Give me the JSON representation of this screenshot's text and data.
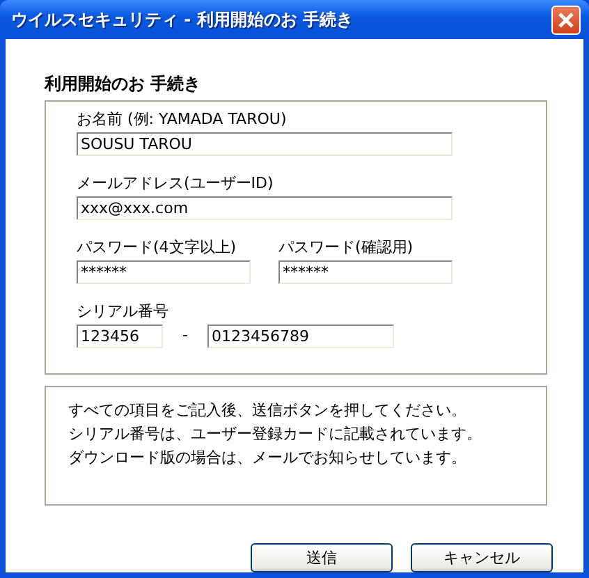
{
  "window": {
    "title": "ウイルスセキュリティ - 利用開始のお 手続き"
  },
  "heading": "利用開始のお 手続き",
  "fields": [
    {
      "label": "お名前 (例: YAMADA TAROU)",
      "value": "SOUSU TAROU"
    },
    {
      "label": "メールアドレス(ユーザーID)",
      "value": "xxx@xxx.com"
    }
  ],
  "passwords": [
    {
      "label": "パスワード(4文字以上)",
      "value": "******"
    },
    {
      "label": "パスワード(確認用)",
      "value": "******"
    }
  ],
  "serial": {
    "label": "シリアル番号",
    "part_1": "123456",
    "separator": "-",
    "part_2": "0123456789"
  },
  "info": [
    "すべての項目をご記入後、送信ボタンを押してください。",
    "シリアル番号は、ユーザー登録カードに記載されています。",
    "ダウンロード版の場合は、メールでお知らせしています。"
  ],
  "buttons": [
    "送信",
    "キャンセル"
  ]
}
